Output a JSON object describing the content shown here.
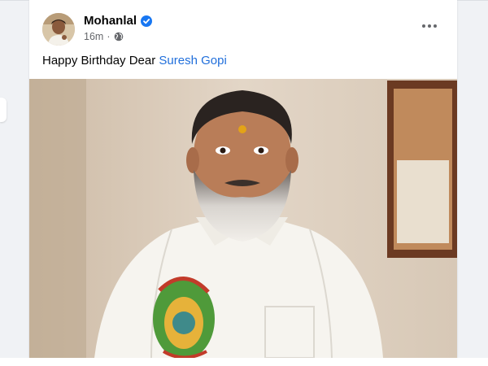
{
  "post": {
    "author": "Mohanlal",
    "timestamp": "16m",
    "audience_icon": "globe-icon",
    "text_prefix": "Happy Birthday Dear ",
    "mention": "Suresh Gopi",
    "photo_subject": "photo"
  },
  "colors": {
    "feed_bg": "#f0f2f5",
    "verified_blue": "#1877f2",
    "link_blue": "#216fdb",
    "secondary_text": "#65676b"
  }
}
